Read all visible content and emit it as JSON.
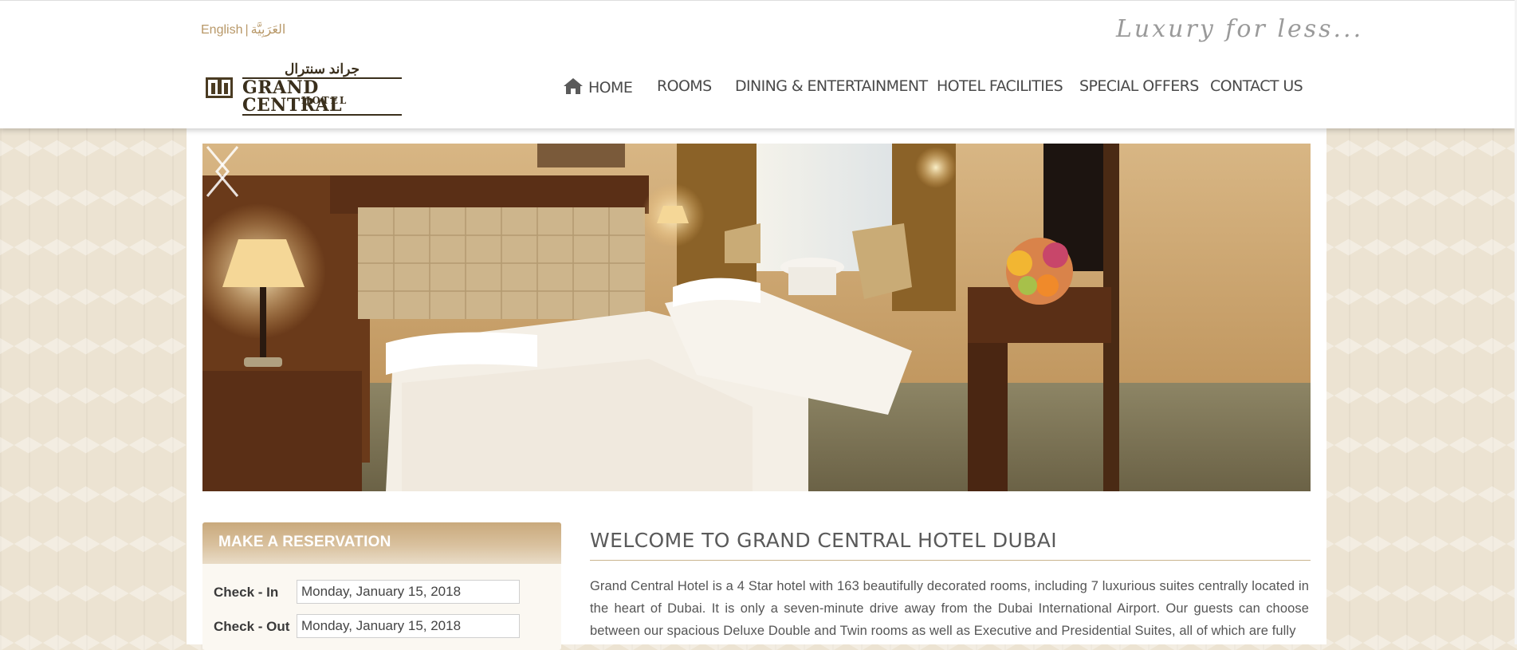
{
  "language": {
    "english": "English",
    "separator": "|",
    "arabic": "العَرَبِيَّة"
  },
  "tagline": "Luxury for less...",
  "logo": {
    "arabic": "جراند سنترال",
    "name": "GRAND CENTRAL",
    "sub": "HOTEL",
    "icon": "hotel-building-logo-icon"
  },
  "nav": {
    "items": [
      {
        "label": "HOME",
        "icon": "house-icon"
      },
      {
        "label": "ROOMS"
      },
      {
        "label": "DINING & ENTERTAINMENT"
      },
      {
        "label": "HOTEL FACILITIES"
      },
      {
        "label": "SPECIAL OFFERS"
      },
      {
        "label": "CONTACT US"
      }
    ]
  },
  "slider": {
    "prev_icon": "chevron-left-icon",
    "next_icon": "chevron-right-icon"
  },
  "reservation": {
    "title": "MAKE A RESERVATION",
    "checkin_label": "Check - In",
    "checkin_value": "Monday, January 15, 2018",
    "checkout_label": "Check - Out",
    "checkout_value": "Monday, January 15, 2018"
  },
  "welcome": {
    "title": "WELCOME TO GRAND CENTRAL HOTEL DUBAI",
    "text": "Grand Central Hotel is a 4 Star hotel with 163 beautifully decorated rooms, including 7 luxurious suites centrally located in the heart of Dubai. It is only a seven-minute drive away from the Dubai International Airport. Our guests can choose between our spacious Deluxe Double and Twin rooms as well as Executive and Presidential Suites, all of which are fully"
  },
  "colors": {
    "accent": "#c9a97c",
    "nav_text": "#4a4a4a",
    "lang_text": "#b89868"
  }
}
